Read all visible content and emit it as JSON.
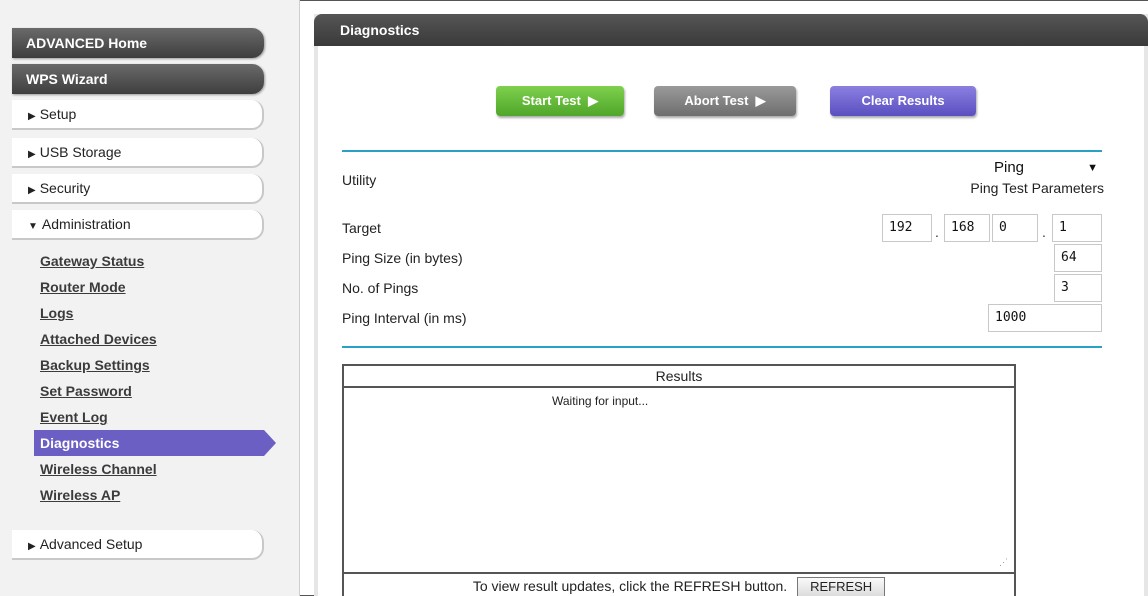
{
  "sidebar": {
    "advanced_home": "ADVANCED Home",
    "wps_wizard": "WPS Wizard",
    "setup": "Setup",
    "usb_storage": "USB Storage",
    "security": "Security",
    "administration": "Administration",
    "advanced_setup": "Advanced Setup",
    "admin_items": [
      "Gateway Status",
      "Router Mode",
      "Logs",
      "Attached Devices",
      "Backup Settings",
      "Set Password",
      "Event Log",
      "Diagnostics",
      "Wireless Channel",
      "Wireless AP"
    ],
    "active_item": "Diagnostics"
  },
  "main": {
    "title": "Diagnostics",
    "buttons": {
      "start": "Start Test",
      "abort": "Abort Test",
      "clear": "Clear Results"
    },
    "utility_label": "Utility",
    "utility_value": "Ping",
    "ping_params_label": "Ping Test Parameters",
    "target_label": "Target",
    "target_octets": [
      "192",
      "168",
      "0",
      "1"
    ],
    "ping_size_label": "Ping Size (in bytes)",
    "ping_size_value": "64",
    "num_pings_label": "No. of Pings",
    "num_pings_value": "3",
    "ping_interval_label": "Ping Interval (in ms)",
    "ping_interval_value": "1000",
    "results_title": "Results",
    "results_text": "Waiting for input...",
    "refresh_hint": "To view result updates, click the REFRESH button.",
    "refresh_button": "REFRESH"
  },
  "colors": {
    "start": "#5cb531",
    "abort": "#7d7d7d",
    "clear": "#6b5fc4",
    "active_nav": "#6b5fc4",
    "divider": "#2aa0c8"
  }
}
